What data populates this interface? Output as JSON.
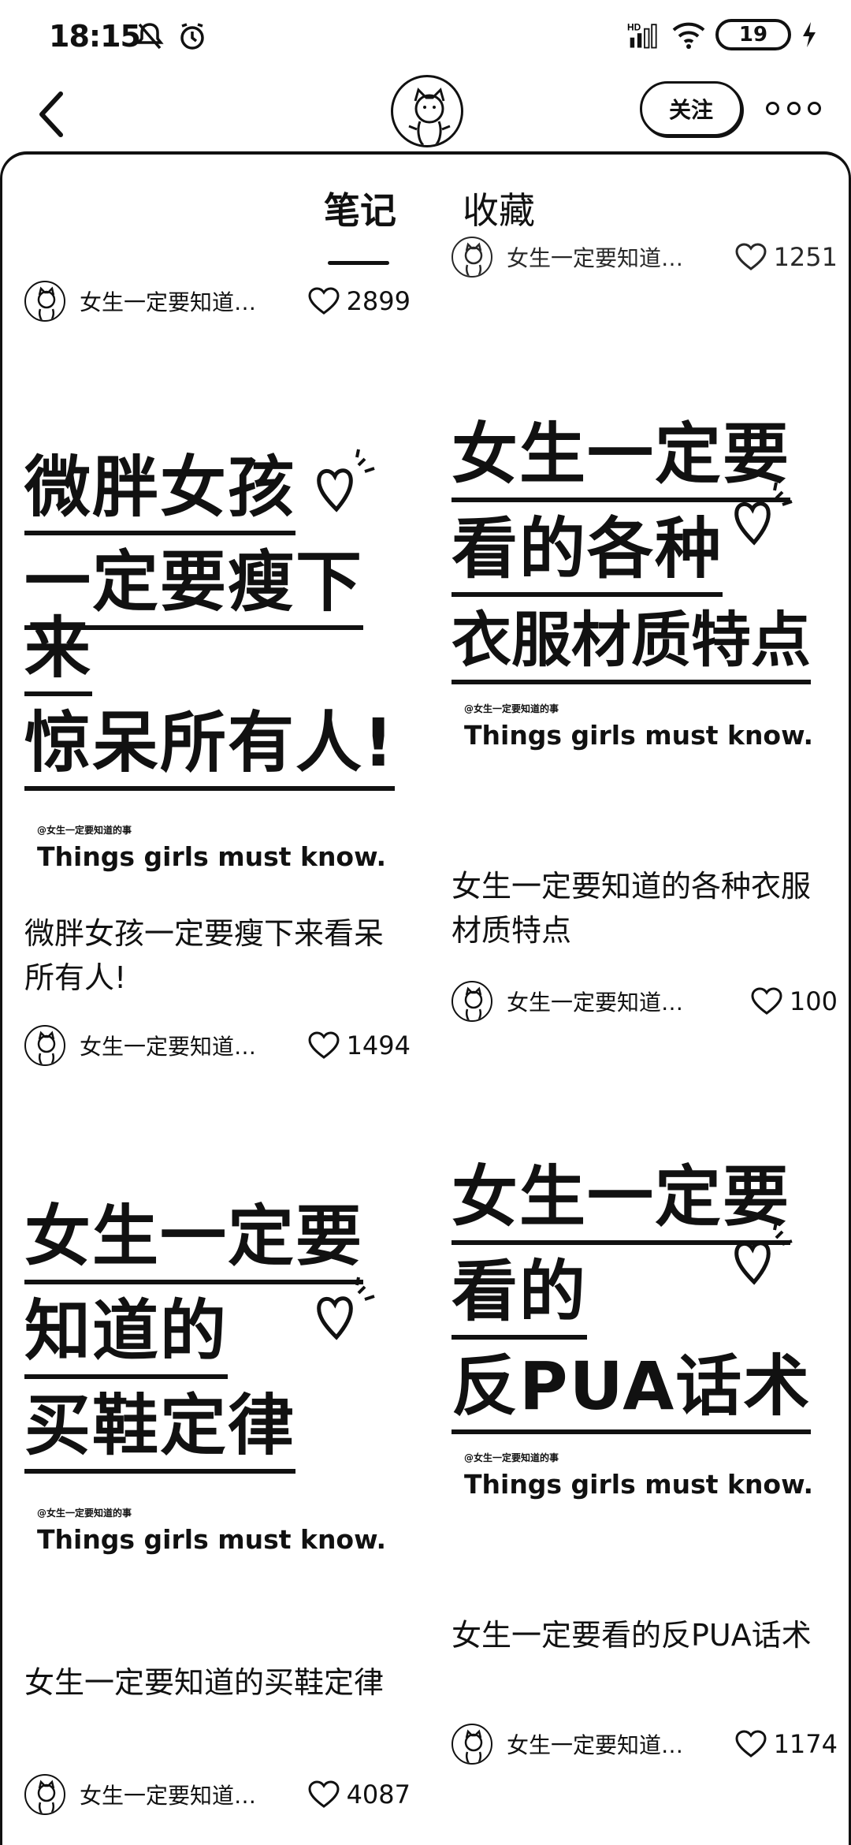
{
  "status_bar": {
    "time": "18:15",
    "battery": "19"
  },
  "nav": {
    "follow_label": "关注"
  },
  "tabs": {
    "notes": "笔记",
    "favorites": "收藏"
  },
  "partial": {
    "left": {
      "author": "女生一定要知道…",
      "likes": "2899"
    },
    "right": {
      "author": "女生一定要知道…",
      "likes": "1251"
    }
  },
  "cards": [
    {
      "cover_lines": [
        "微胖女孩",
        "一定要瘦下来",
        "惊呆所有人!"
      ],
      "cover_tag": "@女生一定要知道的事",
      "cover_sub": "Things girls must know.",
      "title": "微胖女孩一定要瘦下来看呆所有人!",
      "author": "女生一定要知道…",
      "likes": "1494"
    },
    {
      "cover_lines": [
        "女生一定要",
        "看的各种",
        "衣服材质特点"
      ],
      "cover_tag": "@女生一定要知道的事",
      "cover_sub": "Things girls must know.",
      "title": "女生一定要知道的各种衣服材质特点",
      "author": "女生一定要知道的事",
      "likes": "100"
    },
    {
      "cover_lines": [
        "女生一定要",
        "知道的",
        "买鞋定律"
      ],
      "cover_tag": "@女生一定要知道的事",
      "cover_sub": "Things girls must know.",
      "title": "女生一定要知道的买鞋定律",
      "author": "女生一定要知道…",
      "likes": "4087"
    },
    {
      "cover_lines": [
        "女生一定要",
        "看的",
        "反PUA话术"
      ],
      "cover_tag": "@女生一定要知道的事",
      "cover_sub": "Things girls must know.",
      "title": "女生一定要看的反PUA话术",
      "author": "女生一定要知道…",
      "likes": "1174"
    }
  ]
}
